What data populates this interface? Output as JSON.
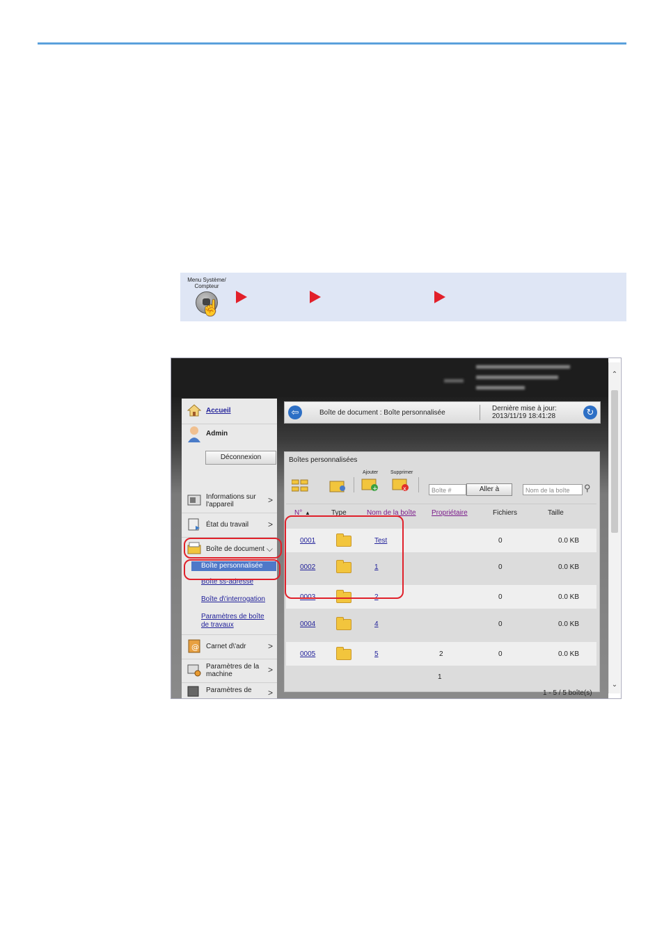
{
  "procedure": {
    "key_label": "Menu Système/ Compteur"
  },
  "nav": {
    "home": "Accueil",
    "user": "Admin",
    "logout": "Déconnexion",
    "items": [
      {
        "label": "Informations sur l'appareil"
      },
      {
        "label": "État du travail"
      },
      {
        "label": "Boîte de document"
      },
      {
        "label": "Carnet d\\'adr"
      },
      {
        "label": "Paramètres de la machine"
      },
      {
        "label": "Paramètres de"
      }
    ],
    "subitems": [
      "Boîte personnalisée",
      "Boîte ss-adresse",
      "Boîte d\\'interrogation",
      "Paramètres de boîte de travaux"
    ]
  },
  "titlebar": {
    "breadcrumb": "Boîte de document : Boîte personnalisée",
    "updated_label": "Dernière mise à jour:",
    "updated_value": "2013/11/19 18:41:28"
  },
  "panel": {
    "title": "Boîtes personnalisées",
    "add_label": "Ajouter",
    "delete_label": "Supprimer",
    "box_placeholder": "Boîte #",
    "goto_label": "Aller à",
    "name_placeholder": "Nom de la boîte",
    "columns": [
      "N°",
      "Type",
      "Nom de la boîte",
      "Propriétaire",
      "Fichiers",
      "Taille"
    ],
    "rows": [
      {
        "no": "0001",
        "name": "Test",
        "owner": "",
        "files": "0",
        "size": "0.0 KB"
      },
      {
        "no": "0002",
        "name": "1",
        "owner": "",
        "files": "0",
        "size": "0.0 KB"
      },
      {
        "no": "0003",
        "name": "2",
        "owner": "",
        "files": "0",
        "size": "0.0 KB"
      },
      {
        "no": "0004",
        "name": "4",
        "owner": "",
        "files": "0",
        "size": "0.0 KB"
      },
      {
        "no": "0005",
        "name": "5",
        "owner": "2",
        "files": "0",
        "size": "0.0 KB"
      }
    ],
    "page": "1",
    "count": "1 - 5 / 5 boîte(s)"
  },
  "colors": {
    "accent": "#5aa0dc",
    "arrow": "#e2202a",
    "highlight_ring": "#e0202a"
  }
}
